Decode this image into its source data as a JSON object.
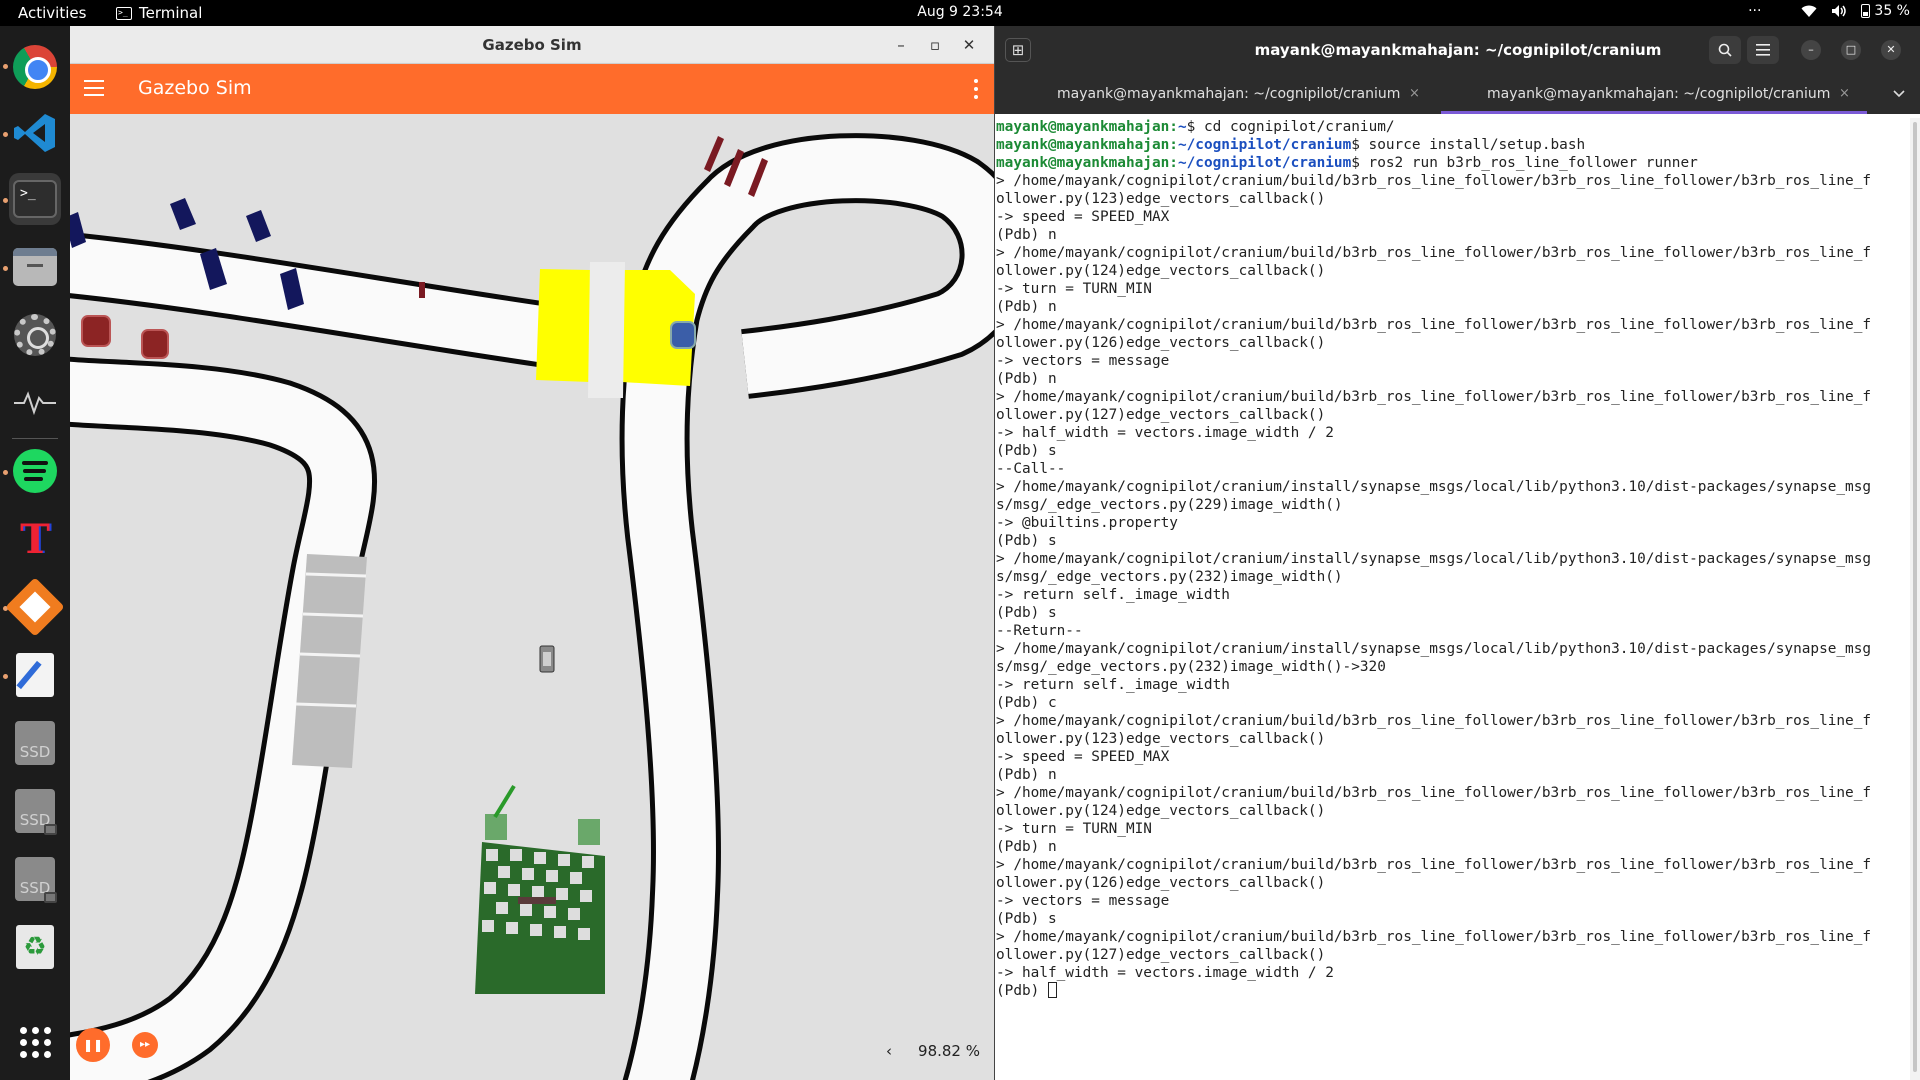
{
  "topbar": {
    "activities": "Activities",
    "app_name": "Terminal",
    "app_icon_glyph": ">_",
    "clock": "Aug 9  23:54",
    "overflow": "···",
    "wifi_icon": "wifi-icon",
    "volume_icon": "volume-icon",
    "battery": "35 %"
  },
  "dock": {
    "items": [
      "Google Chrome",
      "Visual Studio Code",
      "Terminal",
      "Files",
      "Settings",
      "System Monitor",
      "Spotify",
      "TeXstudio",
      "Archive Manager",
      "Text Editor",
      "SSD",
      "SSD",
      "SSD",
      "Rubbish Bin",
      "Show Applications"
    ],
    "ssd_label": "SSD",
    "trash_glyph": "♻"
  },
  "gazebo": {
    "window_title": "Gazebo Sim",
    "header_title": "Gazebo Sim",
    "pause_glyph": "❚❚",
    "step_glyph": "▸▸",
    "rtf_chevron": "‹",
    "real_time_factor": "98.82 %",
    "colors": {
      "header": "#ff6c2b",
      "floor": "#e0e0e0",
      "track": "#ffffff",
      "gate": "#ffff00"
    }
  },
  "terminal": {
    "window_title": "mayank@mayankmahajan: ~/cognipilot/cranium",
    "tabs": [
      {
        "label": "mayank@mayankmahajan: ~/cognipilot/cranium"
      },
      {
        "label": "mayank@mayankmahajan: ~/cognipilot/cranium"
      }
    ],
    "close_glyph": "×",
    "lines": [
      {
        "user": "mayank@mayankmahajan",
        "path": "~",
        "cmd": "$ cd cognipilot/cranium/"
      },
      {
        "user": "mayank@mayankmahajan",
        "path": "~/cognipilot/cranium",
        "cmd": "$ source install/setup.bash"
      },
      {
        "user": "mayank@mayankmahajan",
        "path": "~/cognipilot/cranium",
        "cmd": "$ ros2 run b3rb_ros_line_follower runner"
      },
      {
        "text": "> /home/mayank/cognipilot/cranium/build/b3rb_ros_line_follower/b3rb_ros_line_follower/b3rb_ros_line_f"
      },
      {
        "text": "ollower.py(123)edge_vectors_callback()"
      },
      {
        "text": "-> speed = SPEED_MAX"
      },
      {
        "text": "(Pdb) n"
      },
      {
        "text": "> /home/mayank/cognipilot/cranium/build/b3rb_ros_line_follower/b3rb_ros_line_follower/b3rb_ros_line_f"
      },
      {
        "text": "ollower.py(124)edge_vectors_callback()"
      },
      {
        "text": "-> turn = TURN_MIN"
      },
      {
        "text": "(Pdb) n"
      },
      {
        "text": "> /home/mayank/cognipilot/cranium/build/b3rb_ros_line_follower/b3rb_ros_line_follower/b3rb_ros_line_f"
      },
      {
        "text": "ollower.py(126)edge_vectors_callback()"
      },
      {
        "text": "-> vectors = message"
      },
      {
        "text": "(Pdb) n"
      },
      {
        "text": "> /home/mayank/cognipilot/cranium/build/b3rb_ros_line_follower/b3rb_ros_line_follower/b3rb_ros_line_f"
      },
      {
        "text": "ollower.py(127)edge_vectors_callback()"
      },
      {
        "text": "-> half_width = vectors.image_width / 2"
      },
      {
        "text": "(Pdb) s"
      },
      {
        "text": "--Call--"
      },
      {
        "text": "> /home/mayank/cognipilot/cranium/install/synapse_msgs/local/lib/python3.10/dist-packages/synapse_msg"
      },
      {
        "text": "s/msg/_edge_vectors.py(229)image_width()"
      },
      {
        "text": "-> @builtins.property"
      },
      {
        "text": "(Pdb) s"
      },
      {
        "text": "> /home/mayank/cognipilot/cranium/install/synapse_msgs/local/lib/python3.10/dist-packages/synapse_msg"
      },
      {
        "text": "s/msg/_edge_vectors.py(232)image_width()"
      },
      {
        "text": "-> return self._image_width"
      },
      {
        "text": "(Pdb) s"
      },
      {
        "text": "--Return--"
      },
      {
        "text": "> /home/mayank/cognipilot/cranium/install/synapse_msgs/local/lib/python3.10/dist-packages/synapse_msg"
      },
      {
        "text": "s/msg/_edge_vectors.py(232)image_width()->320"
      },
      {
        "text": "-> return self._image_width"
      },
      {
        "text": "(Pdb) c"
      },
      {
        "text": "> /home/mayank/cognipilot/cranium/build/b3rb_ros_line_follower/b3rb_ros_line_follower/b3rb_ros_line_f"
      },
      {
        "text": "ollower.py(123)edge_vectors_callback()"
      },
      {
        "text": "-> speed = SPEED_MAX"
      },
      {
        "text": "(Pdb) n"
      },
      {
        "text": "> /home/mayank/cognipilot/cranium/build/b3rb_ros_line_follower/b3rb_ros_line_follower/b3rb_ros_line_f"
      },
      {
        "text": "ollower.py(124)edge_vectors_callback()"
      },
      {
        "text": "-> turn = TURN_MIN"
      },
      {
        "text": "(Pdb) n"
      },
      {
        "text": "> /home/mayank/cognipilot/cranium/build/b3rb_ros_line_follower/b3rb_ros_line_follower/b3rb_ros_line_f"
      },
      {
        "text": "ollower.py(126)edge_vectors_callback()"
      },
      {
        "text": "-> vectors = message"
      },
      {
        "text": "(Pdb) s"
      },
      {
        "text": "> /home/mayank/cognipilot/cranium/build/b3rb_ros_line_follower/b3rb_ros_line_follower/b3rb_ros_line_f"
      },
      {
        "text": "ollower.py(127)edge_vectors_callback()"
      },
      {
        "text": "-> half_width = vectors.image_width / 2"
      }
    ],
    "prompt": "(Pdb) "
  }
}
